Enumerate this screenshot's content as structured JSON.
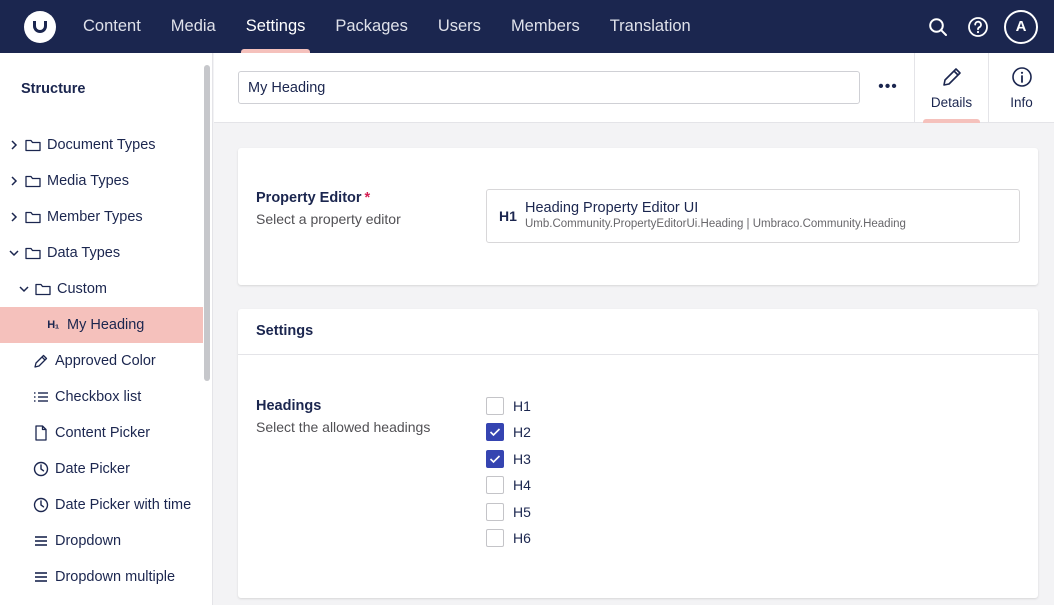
{
  "topbar": {
    "nav": [
      "Content",
      "Media",
      "Settings",
      "Packages",
      "Users",
      "Members",
      "Translation"
    ],
    "active_index": 2,
    "avatar_initial": "A",
    "colors": {
      "bar": "#1b264f",
      "accent": "#f5c1bc"
    }
  },
  "sidebar": {
    "title": "Structure",
    "items": [
      {
        "label": "Document Types",
        "icon": "folder-icon",
        "caret": "right"
      },
      {
        "label": "Media Types",
        "icon": "folder-icon",
        "caret": "right"
      },
      {
        "label": "Member Types",
        "icon": "folder-icon",
        "caret": "right"
      },
      {
        "label": "Data Types",
        "icon": "folder-icon",
        "caret": "down"
      },
      {
        "label": "Custom",
        "icon": "folder-icon",
        "caret": "down"
      },
      {
        "label": "My Heading",
        "icon": "heading-icon",
        "active": true
      },
      {
        "label": "Approved Color",
        "icon": "eyedropper-icon"
      },
      {
        "label": "Checkbox list",
        "icon": "list-icon"
      },
      {
        "label": "Content Picker",
        "icon": "document-icon"
      },
      {
        "label": "Date Picker",
        "icon": "clock-icon"
      },
      {
        "label": "Date Picker with time",
        "icon": "clock-icon"
      },
      {
        "label": "Dropdown",
        "icon": "menu-icon"
      },
      {
        "label": "Dropdown multiple",
        "icon": "menu-icon"
      }
    ]
  },
  "header": {
    "name_value": "My Heading",
    "more_label": "•••",
    "tabs": {
      "details": "Details",
      "info": "Info"
    }
  },
  "property_editor": {
    "label": "Property Editor",
    "required_mark": "*",
    "description": "Select a property editor",
    "icon_text": "H1",
    "editor_name": "Heading Property Editor UI",
    "editor_alias": "Umb.Community.PropertyEditorUi.Heading | Umbraco.Community.Heading"
  },
  "settings": {
    "title": "Settings",
    "headings_label": "Headings",
    "headings_description": "Select the allowed headings",
    "options": [
      {
        "label": "H1",
        "checked": false
      },
      {
        "label": "H2",
        "checked": true
      },
      {
        "label": "H3",
        "checked": true
      },
      {
        "label": "H4",
        "checked": false
      },
      {
        "label": "H5",
        "checked": false
      },
      {
        "label": "H6",
        "checked": false
      }
    ],
    "colors": {
      "checked": "#3544b1"
    }
  }
}
